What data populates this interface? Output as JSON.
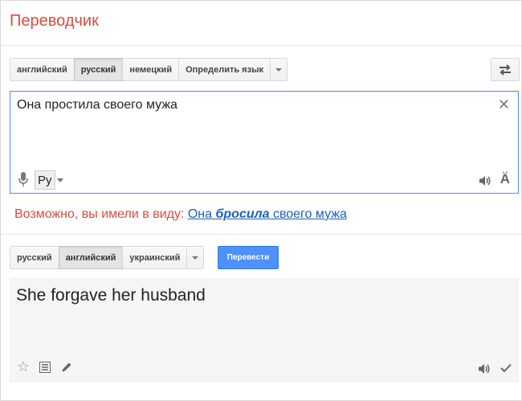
{
  "app": {
    "title": "Переводчик"
  },
  "source_langs": {
    "items": [
      "английский",
      "русский",
      "немецкий",
      "Определить язык"
    ],
    "active": "русский"
  },
  "source": {
    "text": "Она простила своего мужа",
    "ime_label": "Ру"
  },
  "suggestion": {
    "label": "Возможно, вы имели в виду:",
    "link_before": "Она",
    "link_bold": "бросила",
    "link_after": "своего мужа"
  },
  "target_langs": {
    "items": [
      "русский",
      "английский",
      "украинский"
    ],
    "active": "английский"
  },
  "translate_button": "Перевести",
  "result": {
    "text": "She forgave her husband"
  },
  "icons": {
    "swap": "swap-arrows-icon",
    "clear": "close-icon",
    "mic": "microphone-icon",
    "speaker": "speaker-icon",
    "keyboard": "a-umlaut-icon",
    "star": "star-icon",
    "list": "list-icon",
    "edit": "pencil-icon",
    "check": "check-icon"
  },
  "colors": {
    "brand_red": "#dd4b39",
    "accent_blue": "#4d90fe",
    "link_blue": "#1a5fbd"
  }
}
